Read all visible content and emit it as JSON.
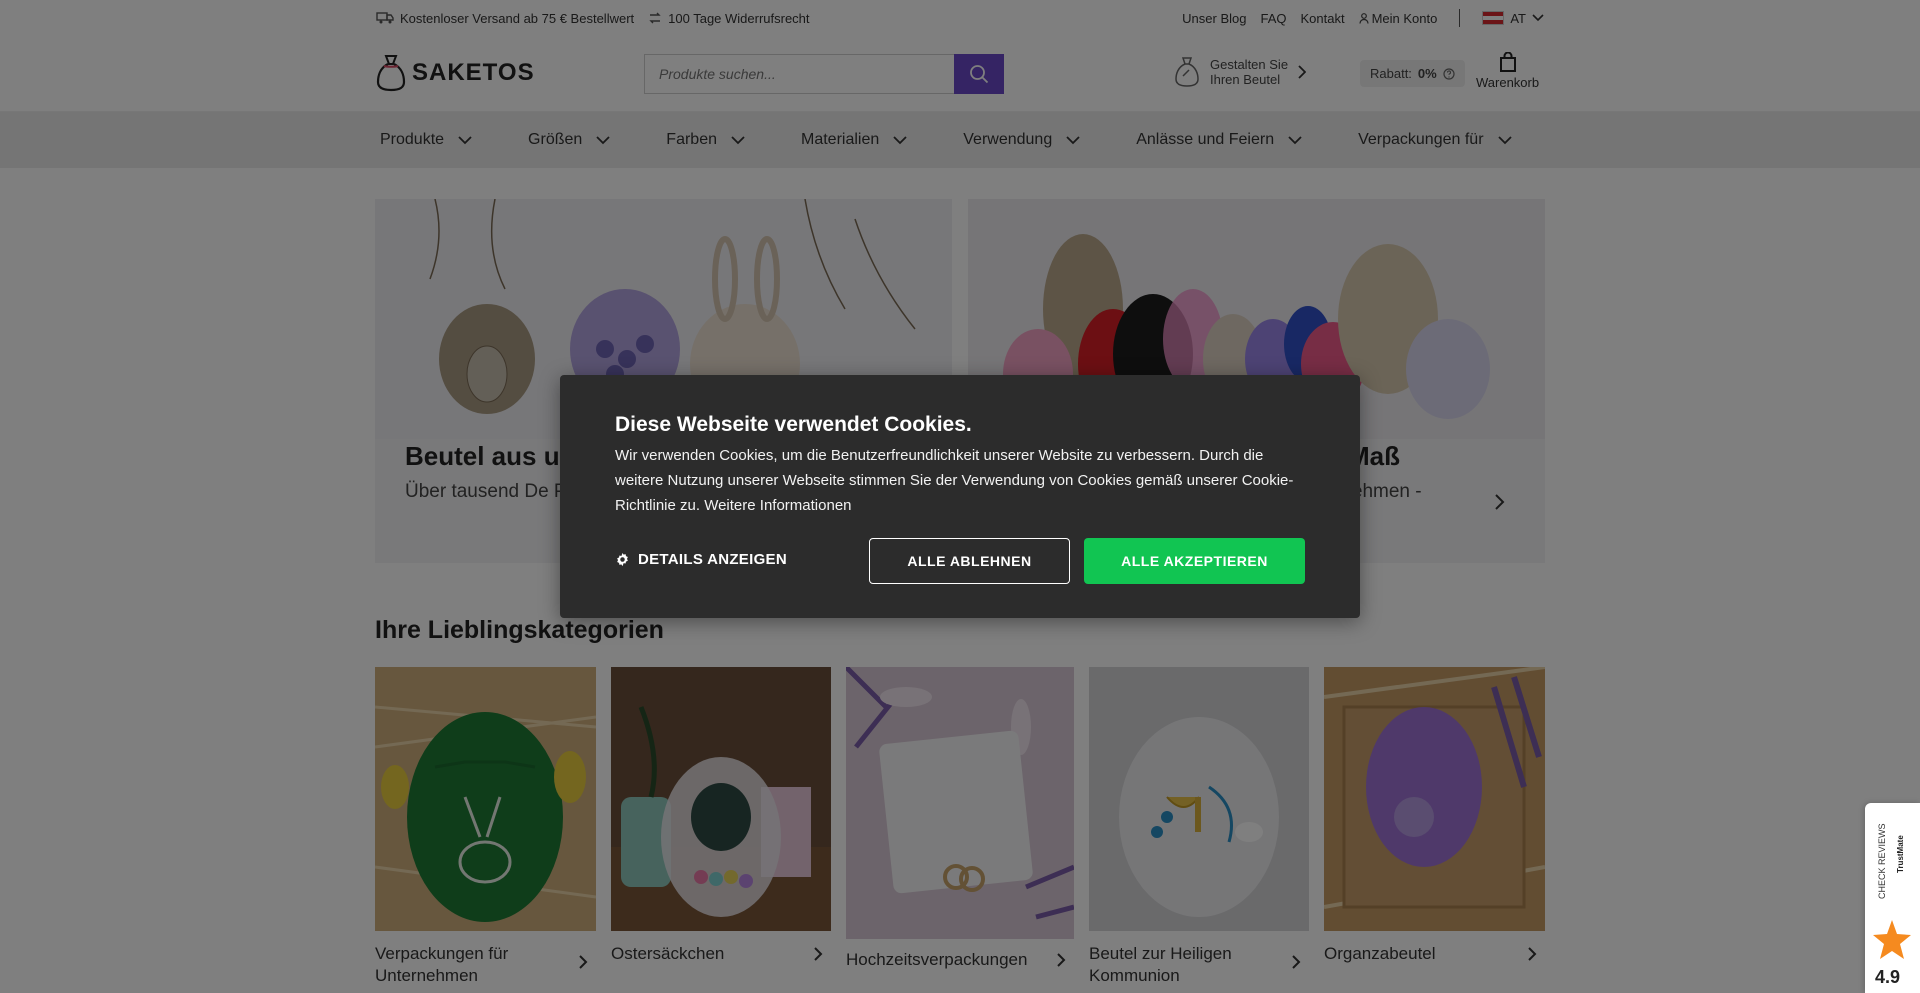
{
  "topbar": {
    "shipping": "Kostenloser Versand ab 75 € Bestellwert",
    "returns": "100 Tage Widerrufsrecht",
    "blog": "Unser Blog",
    "faq": "FAQ",
    "contact": "Kontakt",
    "account": "Mein Konto",
    "country": "AT"
  },
  "header": {
    "logo_text": "SAKETOS",
    "search_placeholder": "Produkte suchen...",
    "design_line1": "Gestalten Sie",
    "design_line2": "Ihren Beutel",
    "rabatt_label": "Rabatt:",
    "rabatt_value": "0%",
    "cart_label": "Warenkorb"
  },
  "nav": {
    "items": [
      {
        "label": "Produkte"
      },
      {
        "label": "Größen"
      },
      {
        "label": "Farben"
      },
      {
        "label": "Materialien"
      },
      {
        "label": "Verwendung"
      },
      {
        "label": "Anlässe und Feiern"
      },
      {
        "label": "Verpackungen für"
      }
    ]
  },
  "banners": [
    {
      "title": "Beutel aus u",
      "sub": "Über tausend De Personalisierung"
    },
    {
      "title": "Maß",
      "sub": "rnehmen -"
    }
  ],
  "categories": {
    "title": "Ihre Lieblingskategorien",
    "items": [
      {
        "label": "Verpackungen für Unternehmen"
      },
      {
        "label": "Ostersäckchen"
      },
      {
        "label": "Hochzeitsverpackungen"
      },
      {
        "label": "Beutel zur Heiligen Kommunion"
      },
      {
        "label": "Organzabeutel"
      }
    ]
  },
  "cookie": {
    "title": "Diese Webseite verwendet Cookies.",
    "text": "Wir verwenden Cookies, um die Benutzerfreundlichkeit unserer Website zu verbessern. Durch die weitere Nutzung unserer Webseite stimmen Sie der Verwendung von Cookies gemäß unserer Cookie-Richtlinie zu. Weitere Informationen",
    "details": "DETAILS ANZEIGEN",
    "reject": "ALLE ABLEHNEN",
    "accept": "ALLE AKZEPTIEREN"
  },
  "trustmate": {
    "label": "CHECK REVIEWS",
    "brand": "TrustMate",
    "rating": "4.9"
  },
  "colors": {
    "accent": "#6a49c8",
    "accept": "#11c552",
    "modal_bg": "#2c2c2c"
  }
}
